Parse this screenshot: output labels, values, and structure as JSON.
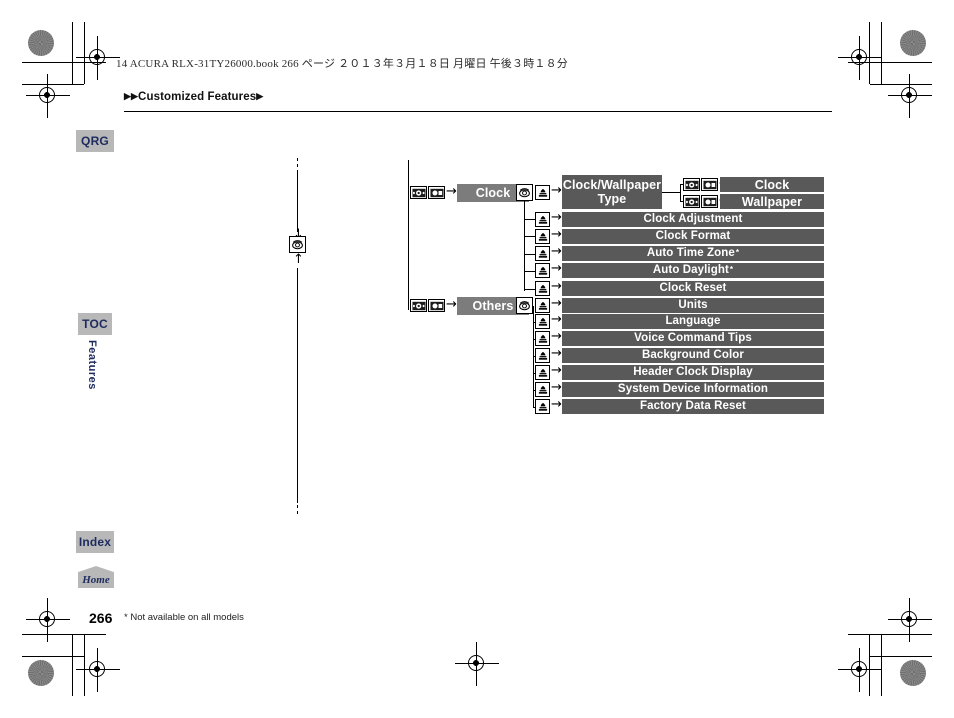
{
  "document": {
    "book_line": "14 ACURA RLX-31TY26000.book   266 ページ   ２０１３年３月１８日   月曜日   午後３時１８分",
    "breadcrumb": "Customized Features",
    "page_number": "266",
    "footnote": "* Not available on all models"
  },
  "tabs": {
    "qrg": "QRG",
    "toc": "TOC",
    "index": "Index",
    "home": "Home",
    "section_label": "Features"
  },
  "colors": {
    "bar_primary": "#7c7c7c",
    "bar_item": "#595959",
    "tab_bg": "#b8b8b8",
    "tab_text": "#1e2b5e"
  },
  "diagram": {
    "type": "menu-flow",
    "branches": [
      {
        "id": "clock",
        "label": "Clock",
        "entry_icons": [
          "interface-dial-icon",
          "interface-enter-icon"
        ],
        "select_icons": [
          "rotary-dial-icon",
          "press-enter-icon"
        ],
        "items": [
          {
            "label": "Clock/Wallpaper Type",
            "icon": "press-enter-icon",
            "children": [
              {
                "label": "Clock",
                "icons": [
                  "interface-dial-icon",
                  "interface-enter-icon"
                ]
              },
              {
                "label": "Wallpaper",
                "icons": [
                  "interface-dial-icon",
                  "interface-enter-icon"
                ]
              }
            ]
          },
          {
            "label": "Clock Adjustment",
            "icon": "press-enter-icon",
            "children": []
          },
          {
            "label": "Clock Format",
            "icon": "press-enter-icon",
            "children": []
          },
          {
            "label": "Auto Time Zone",
            "footnote_mark": "*",
            "icon": "press-enter-icon",
            "children": []
          },
          {
            "label": "Auto Daylight",
            "footnote_mark": "*",
            "icon": "press-enter-icon",
            "children": []
          },
          {
            "label": "Clock Reset",
            "icon": "press-enter-icon",
            "children": []
          }
        ]
      },
      {
        "id": "others",
        "label": "Others",
        "entry_icons": [
          "interface-dial-icon",
          "interface-enter-icon"
        ],
        "select_icons": [
          "rotary-dial-icon"
        ],
        "items": [
          {
            "label": "Units",
            "icon": "press-enter-icon",
            "children": []
          },
          {
            "label": "Language",
            "icon": "press-enter-icon",
            "children": []
          },
          {
            "label": "Voice Command Tips",
            "icon": "press-enter-icon",
            "children": []
          },
          {
            "label": "Background Color",
            "icon": "press-enter-icon",
            "children": []
          },
          {
            "label": "Header Clock Display",
            "icon": "press-enter-icon",
            "children": []
          },
          {
            "label": "System Device Information",
            "icon": "press-enter-icon",
            "children": []
          },
          {
            "label": "Factory Data Reset",
            "icon": "press-enter-icon",
            "children": []
          }
        ]
      }
    ],
    "center_icon": "rotary-dial-icon"
  }
}
